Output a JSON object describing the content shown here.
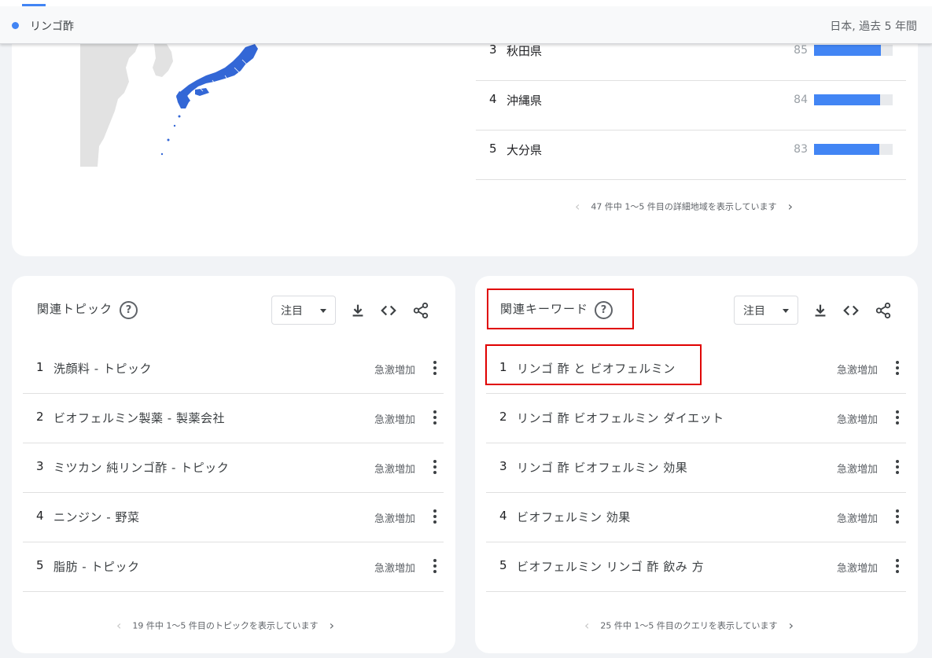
{
  "search": {
    "term": "リンゴ酢",
    "range": "日本, 過去 5 年間"
  },
  "regions": {
    "rows": [
      {
        "rank": "3",
        "name": "秋田県",
        "value": "85",
        "fraction": 0.85
      },
      {
        "rank": "4",
        "name": "沖縄県",
        "value": "84",
        "fraction": 0.84
      },
      {
        "rank": "5",
        "name": "大分県",
        "value": "83",
        "fraction": 0.83
      }
    ],
    "pager": "47 件中 1〜5 件目の詳細地域を表示しています"
  },
  "topics": {
    "title": "関連トピック",
    "filter": "注目",
    "rows": [
      {
        "rank": "1",
        "text": "洗顔料 - トピック",
        "status": "急激増加"
      },
      {
        "rank": "2",
        "text": "ビオフェルミン製薬 - 製薬会社",
        "status": "急激増加"
      },
      {
        "rank": "3",
        "text": "ミツカン 純リンゴ酢 - トピック",
        "status": "急激増加"
      },
      {
        "rank": "4",
        "text": "ニンジン - 野菜",
        "status": "急激増加"
      },
      {
        "rank": "5",
        "text": "脂肪 - トピック",
        "status": "急激増加"
      }
    ],
    "pager": "19 件中 1〜5 件目のトピックを表示しています"
  },
  "queries": {
    "title": "関連キーワード",
    "filter": "注目",
    "rows": [
      {
        "rank": "1",
        "text": "リンゴ 酢 と ビオフェルミン",
        "status": "急激増加"
      },
      {
        "rank": "2",
        "text": "リンゴ 酢 ビオフェルミン ダイエット",
        "status": "急激増加"
      },
      {
        "rank": "3",
        "text": "リンゴ 酢 ビオフェルミン 効果",
        "status": "急激増加"
      },
      {
        "rank": "4",
        "text": "ビオフェルミン 効果",
        "status": "急激増加"
      },
      {
        "rank": "5",
        "text": "ビオフェルミン リンゴ 酢 飲み 方",
        "status": "急激増加"
      }
    ],
    "pager": "25 件中 1〜5 件目のクエリを表示しています"
  },
  "icons": {
    "help": "?",
    "accent": "#4285f4",
    "highlight": "#e00000"
  }
}
